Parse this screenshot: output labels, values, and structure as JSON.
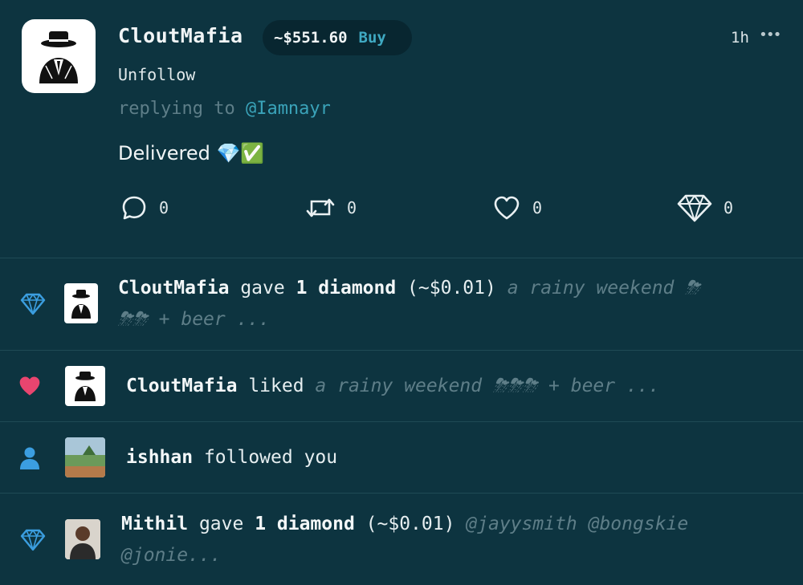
{
  "post": {
    "username": "CloutMafia",
    "price": "~$551.60",
    "buy_label": "Buy",
    "time": "1h",
    "more": "•••",
    "follow_label": "Unfollow",
    "replying_prefix": "replying to ",
    "replying_handle": "@Iamnayr",
    "body": "Delivered 💎✅",
    "actions": {
      "comments": "0",
      "reposts": "0",
      "likes": "0",
      "diamonds": "0"
    }
  },
  "notifications": [
    {
      "type": "diamond",
      "user": "CloutMafia",
      "action": " gave ",
      "amount": "1 diamond",
      "value": " (~$0.01) ",
      "snippet_line1": "a rainy weekend ⛈",
      "snippet_line2": "⛈⛈ + beer ..."
    },
    {
      "type": "like",
      "user": "CloutMafia",
      "action": " liked ",
      "snippet": "a rainy weekend ⛈⛈⛈ + beer ..."
    },
    {
      "type": "follow",
      "user": "ishhan",
      "action": " followed you"
    },
    {
      "type": "diamond",
      "user": "Mithil",
      "action": " gave ",
      "amount": "1 diamond",
      "value": " (~$0.01) ",
      "snippet_line1": "@jayysmith @bongskie",
      "snippet_line2": "@jonie..."
    }
  ],
  "colors": {
    "background": "#0d3440",
    "accent": "#3aa3b9",
    "diamond_blue": "#3b9ee0",
    "heart_pink": "#e8456f"
  }
}
